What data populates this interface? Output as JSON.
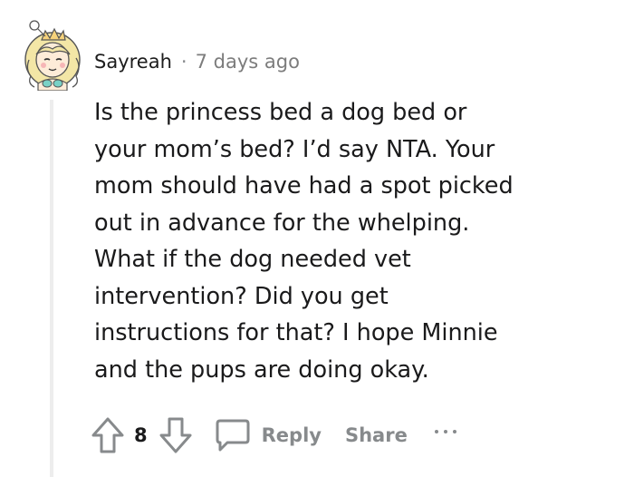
{
  "comment": {
    "author": "Sayreah",
    "separator": "·",
    "timestamp": "7 days ago",
    "avatar_icon": "princess-avatar-icon",
    "lines": [
      "Is the princess bed a dog bed or",
      "your mom’s bed? I’d say NTA. Your",
      "mom should have had a spot picked",
      "out in advance for the whelping.",
      "What if the dog needed vet",
      "intervention? Did you get",
      "instructions for that? I hope Minnie",
      "and the pups are doing okay."
    ]
  },
  "actions": {
    "upvote_icon": "upvote-arrow-icon",
    "vote_count": "8",
    "downvote_icon": "downvote-arrow-icon",
    "reply_icon": "speech-bubble-icon",
    "reply_label": "Reply",
    "share_label": "Share",
    "more_icon": "more-dots-icon"
  },
  "colors": {
    "text": "#1a1a1b",
    "muted": "#878a8c",
    "thread_line": "#ededed"
  }
}
